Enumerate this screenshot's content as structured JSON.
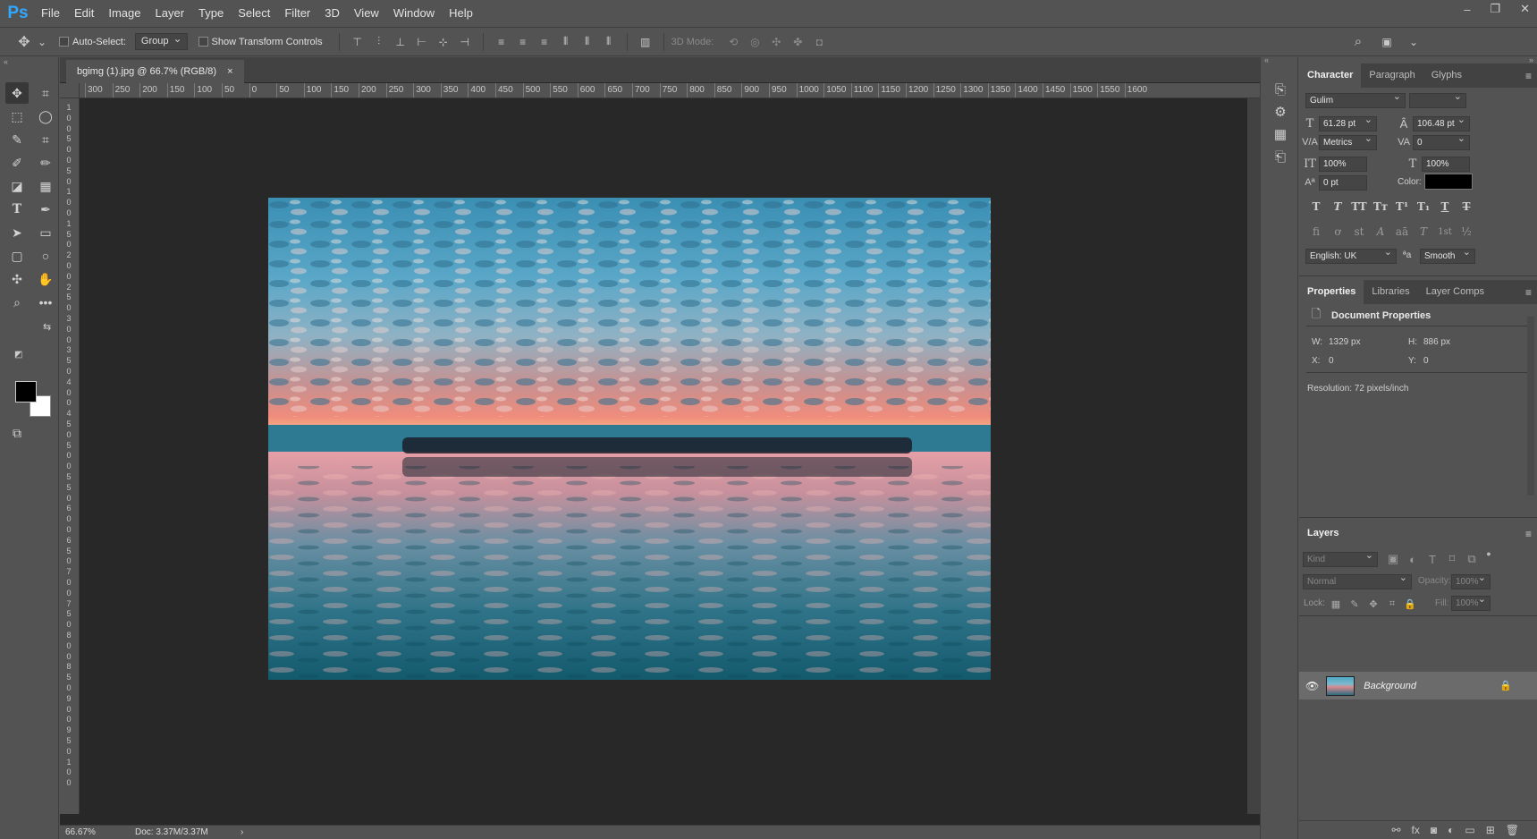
{
  "menubar": {
    "logo": "Ps",
    "items": [
      "File",
      "Edit",
      "Image",
      "Layer",
      "Type",
      "Select",
      "Filter",
      "3D",
      "View",
      "Window",
      "Help"
    ],
    "window_controls": [
      "–",
      "❐",
      "✕"
    ]
  },
  "options": {
    "auto_select_label": "Auto-Select:",
    "auto_select_value": "Group",
    "transform_controls_label": "Show Transform Controls",
    "mode_3d_label": "3D Mode:"
  },
  "document": {
    "tab_title": "bgimg (1).jpg @ 66.7% (RGB/8)",
    "tab_close": "×",
    "ruler_h_labels": [
      "300",
      "250",
      "200",
      "150",
      "100",
      "50",
      "0",
      "50",
      "100",
      "150",
      "200",
      "250",
      "300",
      "350",
      "400",
      "450",
      "500",
      "550",
      "600",
      "650",
      "700",
      "750",
      "800",
      "850",
      "900",
      "950",
      "1000",
      "1050",
      "1100",
      "1150",
      "1200",
      "1250",
      "1300",
      "1350",
      "1400",
      "1450",
      "1500",
      "1550",
      "1600"
    ],
    "ruler_v_labels": [
      "1",
      "0",
      "0",
      "5",
      "0",
      "0",
      "5",
      "0",
      "1",
      "0",
      "0",
      "1",
      "5",
      "0",
      "2",
      "0",
      "0",
      "2",
      "5",
      "0",
      "3",
      "0",
      "0",
      "3",
      "5",
      "0",
      "4",
      "0",
      "0",
      "4",
      "5",
      "0",
      "5",
      "0",
      "0",
      "5",
      "5",
      "0",
      "6",
      "0",
      "0",
      "6",
      "5",
      "0",
      "7",
      "0",
      "0",
      "7",
      "5",
      "0",
      "8",
      "0",
      "0",
      "8",
      "5",
      "0",
      "9",
      "0",
      "0",
      "9",
      "5",
      "0",
      "1",
      "0",
      "0"
    ],
    "zoom": "66.67%",
    "doc_size": "Doc: 3.37M/3.37M",
    "status_arrow": "›"
  },
  "character": {
    "tabs": [
      "Character",
      "Paragraph",
      "Glyphs"
    ],
    "font_family": "Gulim",
    "font_style": "",
    "font_size": "61.28 pt",
    "leading": "106.48 pt",
    "kerning": "Metrics",
    "tracking": "0",
    "vertical_scale": "100%",
    "horizontal_scale": "100%",
    "baseline_shift": "0 pt",
    "color_label": "Color:",
    "text_color": "#000000",
    "format_buttons": [
      "T",
      "T",
      "TT",
      "Tт",
      "T¹",
      "T₁",
      "T",
      "T"
    ],
    "opentype_buttons": [
      "fi",
      "ơ",
      "st",
      "A",
      "aā",
      "T",
      "1st",
      "½"
    ],
    "language": "English: UK",
    "aa_icon": "ªa",
    "antialias": "Smooth"
  },
  "properties": {
    "tabs": [
      "Properties",
      "Libraries",
      "Layer Comps"
    ],
    "title": "Document Properties",
    "w_label": "W:",
    "w_value": "1329 px",
    "h_label": "H:",
    "h_value": "886 px",
    "x_label": "X:",
    "x_value": "0",
    "y_label": "Y:",
    "y_value": "0",
    "resolution": "Resolution: 72 pixels/inch"
  },
  "layers": {
    "title": "Layers",
    "kind_placeholder": "Kind",
    "blend_mode": "Normal",
    "opacity_label": "Opacity:",
    "opacity_value": "100%",
    "lock_label": "Lock:",
    "fill_label": "Fill:",
    "fill_value": "100%",
    "layer_name": "Background"
  }
}
